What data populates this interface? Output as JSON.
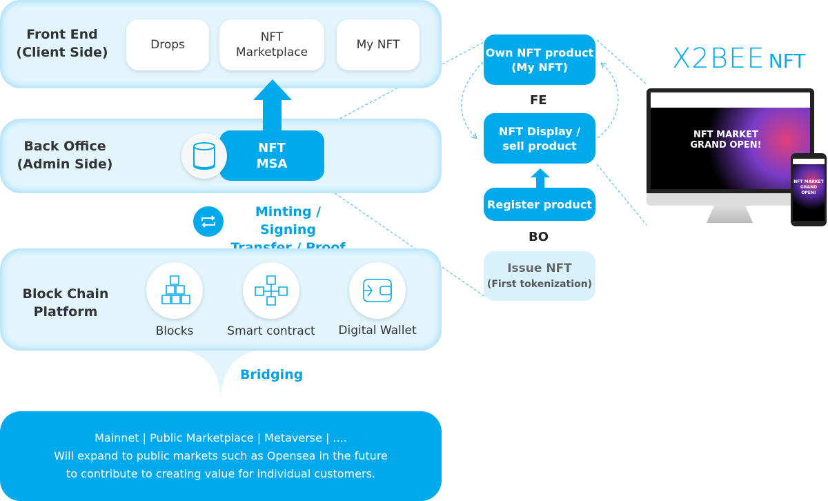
{
  "front_end": {
    "label_line1": "Front End",
    "label_line2": "(Client Side)",
    "boxes": [
      "Drops",
      "NFT",
      "Marketplace",
      "My NFT"
    ]
  },
  "back_office": {
    "label_line1": "Back Office",
    "label_line2": "(Admin Side)",
    "msa_line1": "NFT",
    "msa_line2": "MSA"
  },
  "process": {
    "line1": "Minting / Signing",
    "line2": "Transfer / Proof"
  },
  "blockchain": {
    "label_line1": "Block Chain",
    "label_line2": "Platform",
    "items": [
      "Blocks",
      "Smart contract",
      "Digital Wallet"
    ]
  },
  "bridging": "Bridging",
  "bottom": {
    "line1": "Mainnet | Public Marketplace | Metaverse | ....",
    "line2": "Will expand to public markets such as Opensea in the future",
    "line3": "to contribute to creating value for individual customers."
  },
  "flow": {
    "own_line1": "Own NFT product",
    "own_line2": "(My NFT)",
    "fe": "FE",
    "display_line1": "NFT Display /",
    "display_line2": "sell product",
    "register": "Register product",
    "bo": "BO",
    "issue_line1": "Issue NFT",
    "issue_line2": "(First tokenization)"
  },
  "logo": {
    "brand": "X2BEE",
    "suffix": "NFT"
  },
  "screen": {
    "headline_line1": "NFT MARKET",
    "headline_line2": "GRAND OPEN!"
  },
  "colors": {
    "primary": "#00a9eb",
    "panel": "#e2f5fd",
    "issue_box": "#d9f1fc"
  }
}
